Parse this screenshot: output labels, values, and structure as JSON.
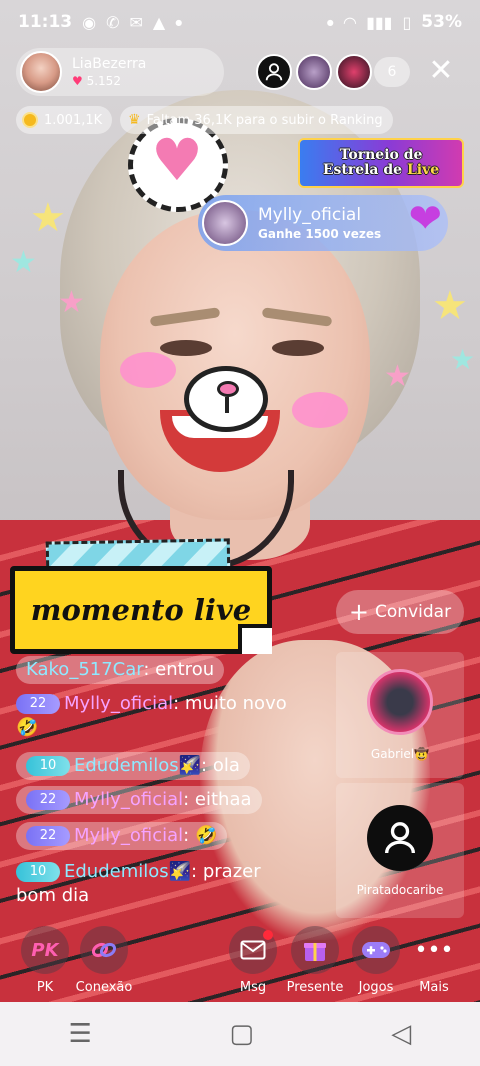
{
  "status_bar": {
    "time": "11:13",
    "battery": "53%",
    "icons": [
      "record-icon",
      "whatsapp-icon",
      "chat-icon",
      "warning-icon",
      "wifi-icon",
      "signal-icon",
      "battery-icon"
    ]
  },
  "host": {
    "name": "LiaBezerra",
    "likes": "5.152"
  },
  "viewers": {
    "count": "6"
  },
  "coins": {
    "amount": "1.001,1K"
  },
  "ranking": {
    "text": "Faltam 36,1K para o subir o Ranking"
  },
  "tournament": {
    "line1": "Torneio de",
    "line2_a": "Estrela de ",
    "line2_b": "Live"
  },
  "gift_notification": {
    "user": "Mylly_oficial",
    "text": "Ganhe 1500 vezes"
  },
  "sticker": {
    "text": "momento live"
  },
  "invite": {
    "label": "Convidar"
  },
  "guests": [
    {
      "name": "Gabriel🤠"
    },
    {
      "name": "Piratadocaribe"
    }
  ],
  "chat": [
    {
      "user": "Kako_517Car",
      "text": ": entrou"
    },
    {
      "level": "22",
      "user": "Mylly_oficial",
      "text": ": muito novo",
      "emoji": "🤣"
    },
    {
      "level": "10",
      "user": "Edudemilos🌠",
      "text": ": ola"
    },
    {
      "level": "22",
      "user": "Mylly_oficial",
      "text": ": eithaa"
    },
    {
      "level": "22",
      "user": "Mylly_oficial",
      "text": ":",
      "emoji": "🤣"
    },
    {
      "level": "10",
      "user": "Edudemilos🌠",
      "text": ": prazer",
      "text2": "bom dia"
    }
  ],
  "bottom_bar": {
    "pk": "PK",
    "pk_label": "PK",
    "connect_label": "Conexão",
    "msg_label": "Msg",
    "gift_label": "Presente",
    "games_label": "Jogos",
    "more_label": "Mais"
  },
  "colors": {
    "accent_pink": "#ff5fb1",
    "level_purple": "#7a72f5",
    "level_teal": "#36c2d9",
    "sticker_yellow": "#ffd41f"
  }
}
